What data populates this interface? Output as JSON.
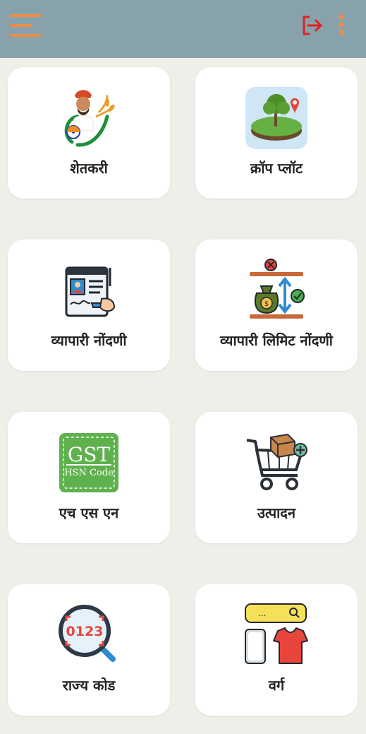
{
  "header": {
    "menu_icon": "hamburger-menu-icon",
    "logout_icon": "logout-icon",
    "more_icon": "more-vertical-icon",
    "colors": {
      "bar": "#87a2ab",
      "accent": "#f08c46",
      "logout": "#e02020"
    }
  },
  "tiles": [
    {
      "label": "शेतकरी",
      "icon": "farmer-icon"
    },
    {
      "label": "क्रॉप प्लॉट",
      "icon": "crop-plot-icon"
    },
    {
      "label": "व्यापारी नोंदणी",
      "icon": "trader-registration-icon"
    },
    {
      "label": "व्यापारी लिमिट नोंदणी",
      "icon": "trader-limit-icon"
    },
    {
      "label": "एच एस एन",
      "icon": "gst-hsn-code-icon",
      "icon_text": [
        "GST",
        "HSN Code"
      ]
    },
    {
      "label": "उत्पादन",
      "icon": "product-cart-icon"
    },
    {
      "label": "राज्य कोड",
      "icon": "state-code-search-icon",
      "icon_text": "0123"
    },
    {
      "label": "वर्ग",
      "icon": "category-icon",
      "icon_text": "..."
    }
  ]
}
